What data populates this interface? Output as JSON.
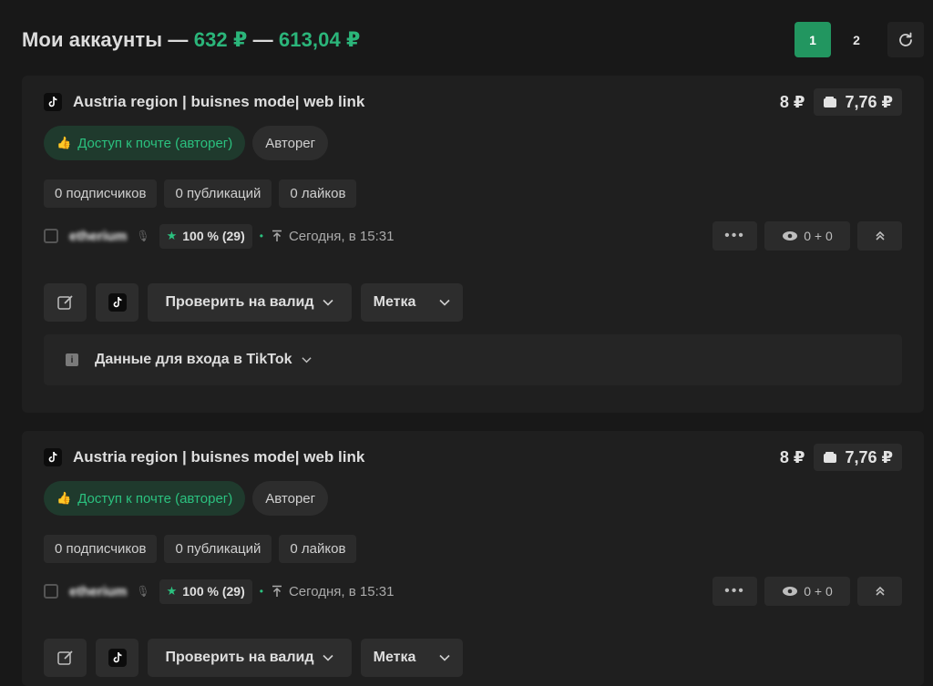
{
  "header": {
    "title": "Мои аккаунты",
    "sep1": "—",
    "sum1": "632 ₽",
    "sep2": "—",
    "sum2": "613,04 ₽"
  },
  "pagination": {
    "pages": [
      "1",
      "2"
    ],
    "active": "1"
  },
  "cards": [
    {
      "title": "Austria region | buisnes mode| web link",
      "price": "8 ₽",
      "price_box": "7,76 ₽",
      "tags": [
        "Доступ к почте (авторег)",
        "Авторег"
      ],
      "stats": [
        "0 подписчиков",
        "0 публикаций",
        "0 лайков"
      ],
      "seller": "etherium",
      "rating": "100 % (29)",
      "date": "Сегодня, в 15:31",
      "views": "0 + 0",
      "check_label": "Проверить на валид",
      "tag_label": "Метка",
      "login_label": "Данные для входа в TikTok"
    },
    {
      "title": "Austria region | buisnes mode| web link",
      "price": "8 ₽",
      "price_box": "7,76 ₽",
      "tags": [
        "Доступ к почте (авторег)",
        "Авторег"
      ],
      "stats": [
        "0 подписчиков",
        "0 публикаций",
        "0 лайков"
      ],
      "seller": "etherium",
      "rating": "100 % (29)",
      "date": "Сегодня, в 15:31",
      "views": "0 + 0",
      "check_label": "Проверить на валид",
      "tag_label": "Метка"
    }
  ],
  "colors": {
    "accent": "#229660",
    "green_text": "#2bb57a",
    "bg": "#181818",
    "card": "#1f1f1f"
  }
}
